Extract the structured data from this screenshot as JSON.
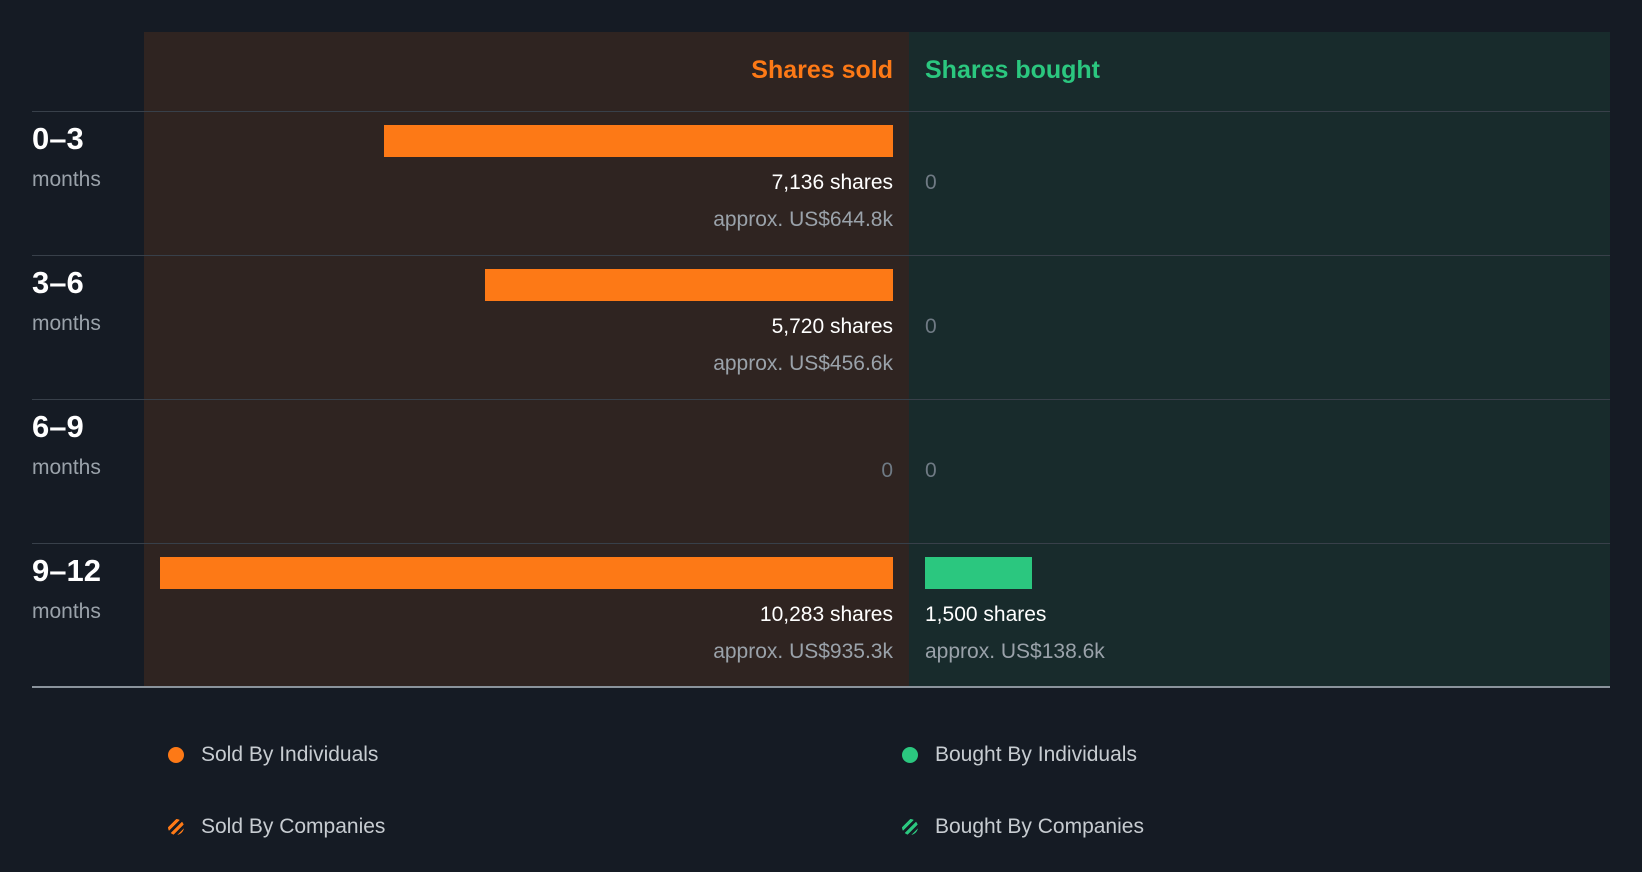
{
  "colors": {
    "sold": "#fd7916",
    "bought": "#2bc77f",
    "sold_panel": "#2f2421",
    "bought_panel": "#182b2c",
    "background": "#151b24"
  },
  "chart_data": {
    "type": "bar",
    "orientation": "horizontal-diverging",
    "headers": {
      "sold": "Shares sold",
      "bought": "Shares bought"
    },
    "categories": [
      {
        "period": "0–3",
        "unit": "months"
      },
      {
        "period": "3–6",
        "unit": "months"
      },
      {
        "period": "6–9",
        "unit": "months"
      },
      {
        "period": "9–12",
        "unit": "months"
      }
    ],
    "series": [
      {
        "name": "Shares sold",
        "values": [
          7136,
          5720,
          0,
          10283
        ],
        "share_labels": [
          "7,136 shares",
          "5,720 shares",
          "0",
          "10,283 shares"
        ],
        "value_labels": [
          "approx. US$644.8k",
          "approx. US$456.6k",
          "",
          "approx. US$935.3k"
        ]
      },
      {
        "name": "Shares bought",
        "values": [
          0,
          0,
          0,
          1500
        ],
        "share_labels": [
          "0",
          "0",
          "0",
          "1,500 shares"
        ],
        "value_labels": [
          "",
          "",
          "",
          "approx. US$138.6k"
        ]
      }
    ],
    "xlim": [
      0,
      10283
    ]
  },
  "legend": [
    {
      "label": "Sold By Individuals",
      "style": "solid",
      "color": "#fd7916"
    },
    {
      "label": "Bought By Individuals",
      "style": "solid",
      "color": "#2bc77f"
    },
    {
      "label": "Sold By Companies",
      "style": "hatched",
      "color": "#fd7916"
    },
    {
      "label": "Bought By Companies",
      "style": "hatched",
      "color": "#2bc77f"
    }
  ]
}
